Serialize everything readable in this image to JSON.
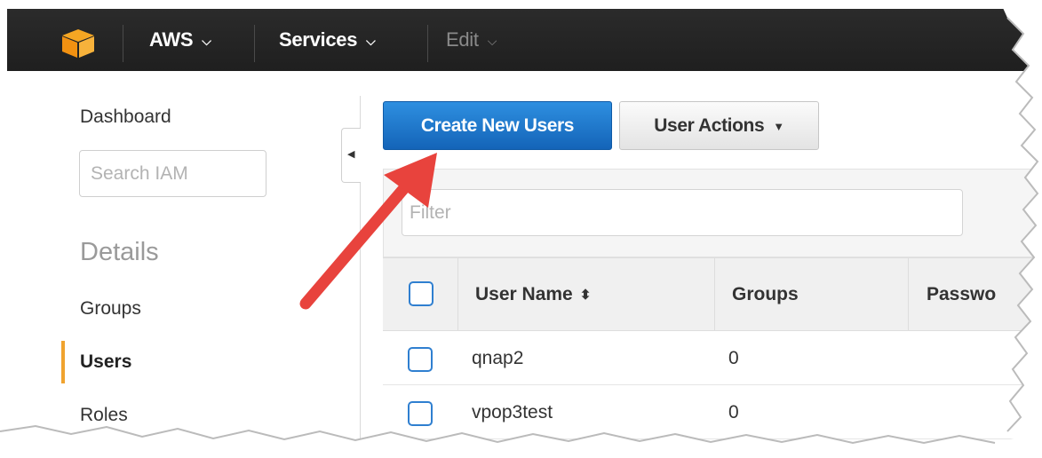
{
  "topnav": {
    "logo_icon": "aws-cube-icon",
    "aws_label": "AWS",
    "services_label": "Services",
    "edit_label": "Edit",
    "caret": "⌄"
  },
  "sidebar": {
    "dashboard": "Dashboard",
    "search_placeholder": "Search IAM",
    "details_heading": "Details",
    "items": [
      {
        "label": "Groups"
      },
      {
        "label": "Users"
      },
      {
        "label": "Roles"
      }
    ],
    "active_color": "#f0a32f"
  },
  "toolbar": {
    "create_label": "Create New Users",
    "actions_label": "User Actions",
    "primary_color": "#1a73c8"
  },
  "filter": {
    "placeholder": "Filter"
  },
  "table": {
    "columns": [
      "User Name",
      "Groups",
      "Passwo"
    ],
    "rows": [
      {
        "name": "qnap2",
        "groups": "0"
      },
      {
        "name": "vpop3test",
        "groups": "0"
      }
    ]
  },
  "annotation": {
    "arrow_color": "#e8433d"
  }
}
